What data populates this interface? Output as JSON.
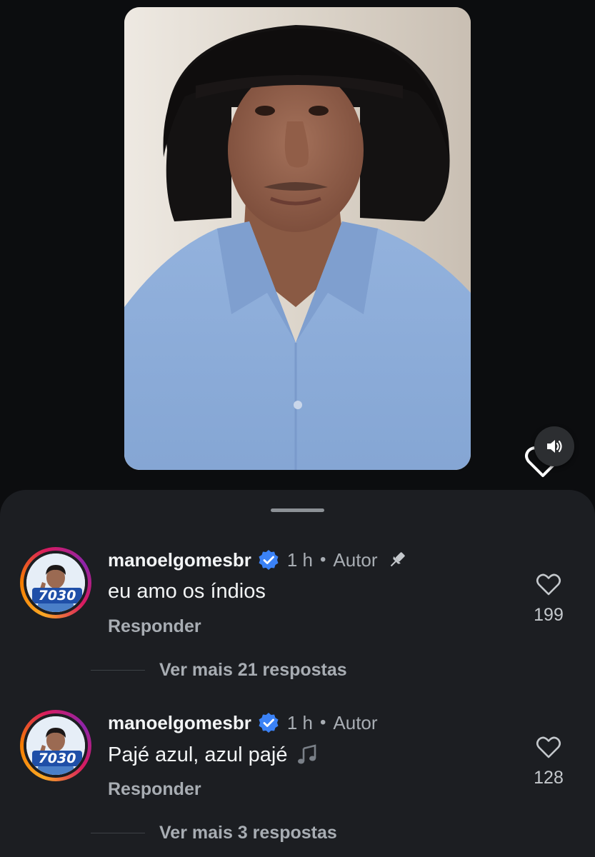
{
  "video": {
    "sound_icon": "speaker-volume-icon",
    "like_icon": "heart-outline-icon"
  },
  "comments": [
    {
      "username": "manoelgomesbr",
      "verified": true,
      "time": "1 h",
      "separator": "•",
      "role": "Autor",
      "pinned": true,
      "text": "eu amo os índios",
      "reply_label": "Responder",
      "likes": "199",
      "view_replies": "Ver mais 21 respostas",
      "avatar_number": "7030"
    },
    {
      "username": "manoelgomesbr",
      "verified": true,
      "time": "1 h",
      "separator": "•",
      "role": "Autor",
      "pinned": false,
      "text": "Pajé azul, azul pajé",
      "reply_label": "Responder",
      "likes": "128",
      "view_replies": "Ver mais 3 respostas",
      "avatar_number": "7030"
    }
  ],
  "colors": {
    "background": "#0c0d0f",
    "sheet": "#1c1e22",
    "verified": "#3b82f6",
    "muted_text": "#a8adb3"
  }
}
